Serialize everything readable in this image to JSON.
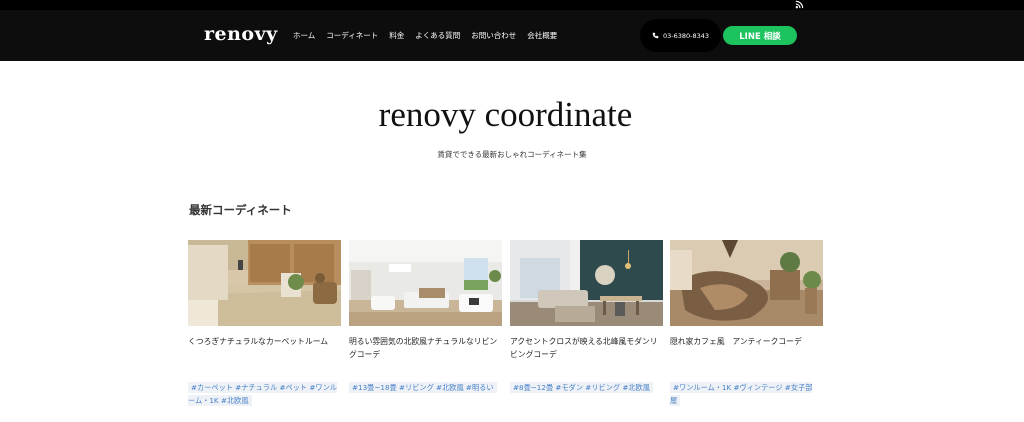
{
  "header": {
    "logo": "renovy",
    "nav": [
      "ホーム",
      "コーディネート",
      "料金",
      "よくある質問",
      "お問い合わせ",
      "会社概要"
    ],
    "phone": "03-6380-8343",
    "line_button": "LINE 相談"
  },
  "hero": {
    "title": "renovy coordinate",
    "subtitle": "賃貸でできる最新おしゃれコーディネート集"
  },
  "section": {
    "title": "最新コーディネート"
  },
  "cards": [
    {
      "title": "くつろぎナチュラルなカーペットルーム",
      "tags": "#カーペット #ナチュラル #ペット #ワンルーム・1K #北欧風"
    },
    {
      "title": "明るい雰囲気の北欧風ナチュラルなリビングコーデ",
      "tags": "#13畳~18畳 #リビング #北欧風 #明るい"
    },
    {
      "title": "アクセントクロスが映える北峰風モダンリビングコーデ",
      "tags": "#8畳~12畳 #モダン #リビング #北欧風"
    },
    {
      "title": "隠れ家カフェ風　アンティークコーデ",
      "tags": "#ワンルーム・1K #ヴィンテージ #女子部屋"
    }
  ],
  "colors": {
    "header_bg": "#0d0d0d",
    "line_green": "#1dc35e",
    "tag_blue": "#4a82c8"
  }
}
